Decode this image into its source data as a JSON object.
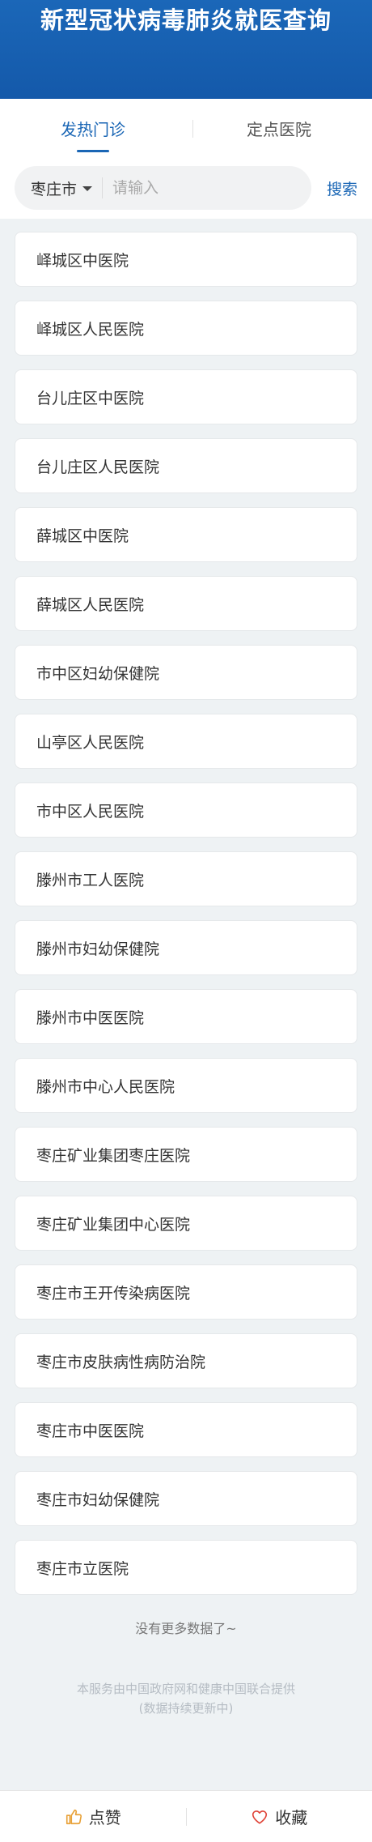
{
  "header": {
    "title": "新型冠状病毒肺炎就医查询"
  },
  "tabs": [
    {
      "label": "发热门诊",
      "active": true
    },
    {
      "label": "定点医院",
      "active": false
    }
  ],
  "search": {
    "city": "枣庄市",
    "placeholder": "请输入",
    "button_label": "搜索"
  },
  "hospitals": [
    "峄城区中医院",
    "峄城区人民医院",
    "台儿庄区中医院",
    "台儿庄区人民医院",
    "薛城区中医院",
    "薛城区人民医院",
    "市中区妇幼保健院",
    "山亭区人民医院",
    "市中区人民医院",
    "滕州市工人医院",
    "滕州市妇幼保健院",
    "滕州市中医医院",
    "滕州市中心人民医院",
    "枣庄矿业集团枣庄医院",
    "枣庄矿业集团中心医院",
    "枣庄市王开传染病医院",
    "枣庄市皮肤病性病防治院",
    "枣庄市中医医院",
    "枣庄市妇幼保健院",
    "枣庄市立医院"
  ],
  "no_more": "没有更多数据了~",
  "footer": {
    "line1": "本服务由中国政府网和健康中国联合提供",
    "line2": "(数据持续更新中)"
  },
  "bottom_bar": {
    "like_label": "点赞",
    "like_icon": "thumbs-up-icon",
    "fav_label": "收藏",
    "fav_icon": "heart-icon"
  },
  "colors": {
    "header_bg": "#1a62b2",
    "accent": "#1a66b5",
    "like_icon": "#e8a23a",
    "fav_icon": "#e0453a"
  }
}
